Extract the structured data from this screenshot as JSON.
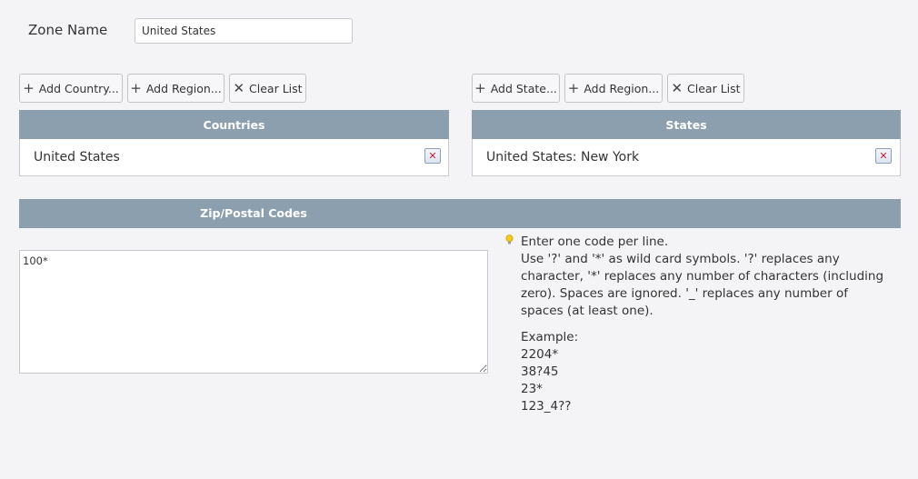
{
  "zone": {
    "label": "Zone Name",
    "value": "United States"
  },
  "countries": {
    "buttons": {
      "add_country": "Add Country...",
      "add_region": "Add Region...",
      "clear_list": "Clear List"
    },
    "header": "Countries",
    "items": [
      "United States"
    ],
    "delete_icon": "close-icon"
  },
  "states": {
    "buttons": {
      "add_state": "Add State...",
      "add_region": "Add Region...",
      "clear_list": "Clear List"
    },
    "header": "States",
    "items": [
      "United States: New York"
    ],
    "delete_icon": "close-icon"
  },
  "zip": {
    "header": "Zip/Postal Codes",
    "value": "100*",
    "help": {
      "icon": "lightbulb-icon",
      "line1": "Enter one code per line.",
      "line2": "Use '?' and '*' as wild card symbols. '?' replaces any character, '*' replaces any number of characters (including zero). Spaces are ignored. '_' replaces any number of spaces (at least one).",
      "example_label": "Example:",
      "examples": [
        "2204*",
        "38?45",
        "23*",
        "123_4??"
      ]
    }
  },
  "colors": {
    "header_bg": "#8c9fae",
    "page_bg": "#f4f4f6",
    "delete_x": "#c0203a"
  }
}
